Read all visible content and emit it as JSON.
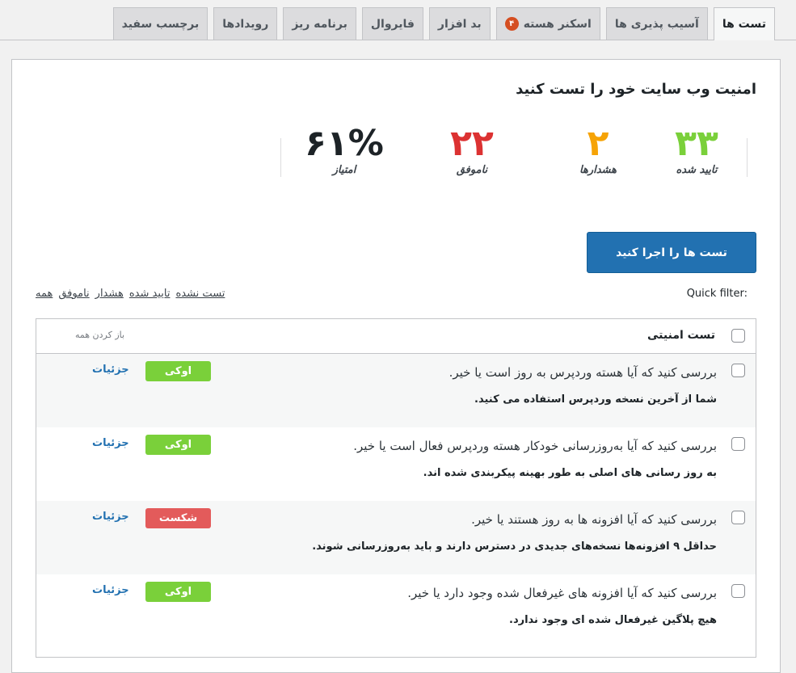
{
  "tabs": [
    {
      "label": "تست ها",
      "active": true
    },
    {
      "label": "آسیب پذیری ها"
    },
    {
      "label": "اسکنر هسته",
      "badge": "۴"
    },
    {
      "label": "بد افزار"
    },
    {
      "label": "فایروال"
    },
    {
      "label": "برنامه ریز"
    },
    {
      "label": "رویدادها"
    },
    {
      "label": "برچسب سفید"
    }
  ],
  "page_title": "امنیت وب سایت خود را تست کنید",
  "stats": [
    {
      "value": "۳۳",
      "label": "تایید شده",
      "color": "#7ad03a"
    },
    {
      "value": "۲",
      "label": "هشدارها",
      "color": "#f6a306"
    },
    {
      "value": "۲۲",
      "label": "ناموفق",
      "color": "#dc3232"
    },
    {
      "value": "۶۱%",
      "label": "امتیاز",
      "color": "#1d2327"
    }
  ],
  "run_button": "تست ها را اجرا کنید",
  "quick_filter": {
    "label": "Quick filter:",
    "options": [
      "تست نشده",
      "تایید شده",
      "هشدار",
      "ناموفق",
      "همه"
    ]
  },
  "table": {
    "header_title": "تست امنیتی",
    "expand_all": "باز کردن همه",
    "rows": [
      {
        "title": "بررسی کنید که آیا هسته وردپرس به روز است یا خیر.",
        "desc": "شما از آخرین نسخه وردپرس استفاده می کنید.",
        "status": "اوکی",
        "status_color": "#7ad03a",
        "details": "جزئیات"
      },
      {
        "title": "بررسی کنید که آیا به‌روزرسانی خودکار هسته وردپرس فعال است یا خیر.",
        "desc": "به روز رسانی های اصلی به طور بهینه پیکربندی شده اند.",
        "status": "اوکی",
        "status_color": "#7ad03a",
        "details": "جزئیات"
      },
      {
        "title": "بررسی کنید که آیا افزونه ها به روز هستند یا خیر.",
        "desc": "حداقل ۹ افزونه‌ها نسخه‌های جدیدی در دسترس دارند و باید به‌روزرسانی شوند.",
        "status": "شکست",
        "status_color": "#e35b5b",
        "details": "جزئیات"
      },
      {
        "title": "بررسی کنید که آیا افزونه های غیرفعال شده وجود دارد یا خیر.",
        "desc": "هیچ پلاگین غیرفعال شده ای وجود ندارد.",
        "status": "اوکی",
        "status_color": "#7ad03a",
        "details": "جزئیات"
      }
    ]
  }
}
